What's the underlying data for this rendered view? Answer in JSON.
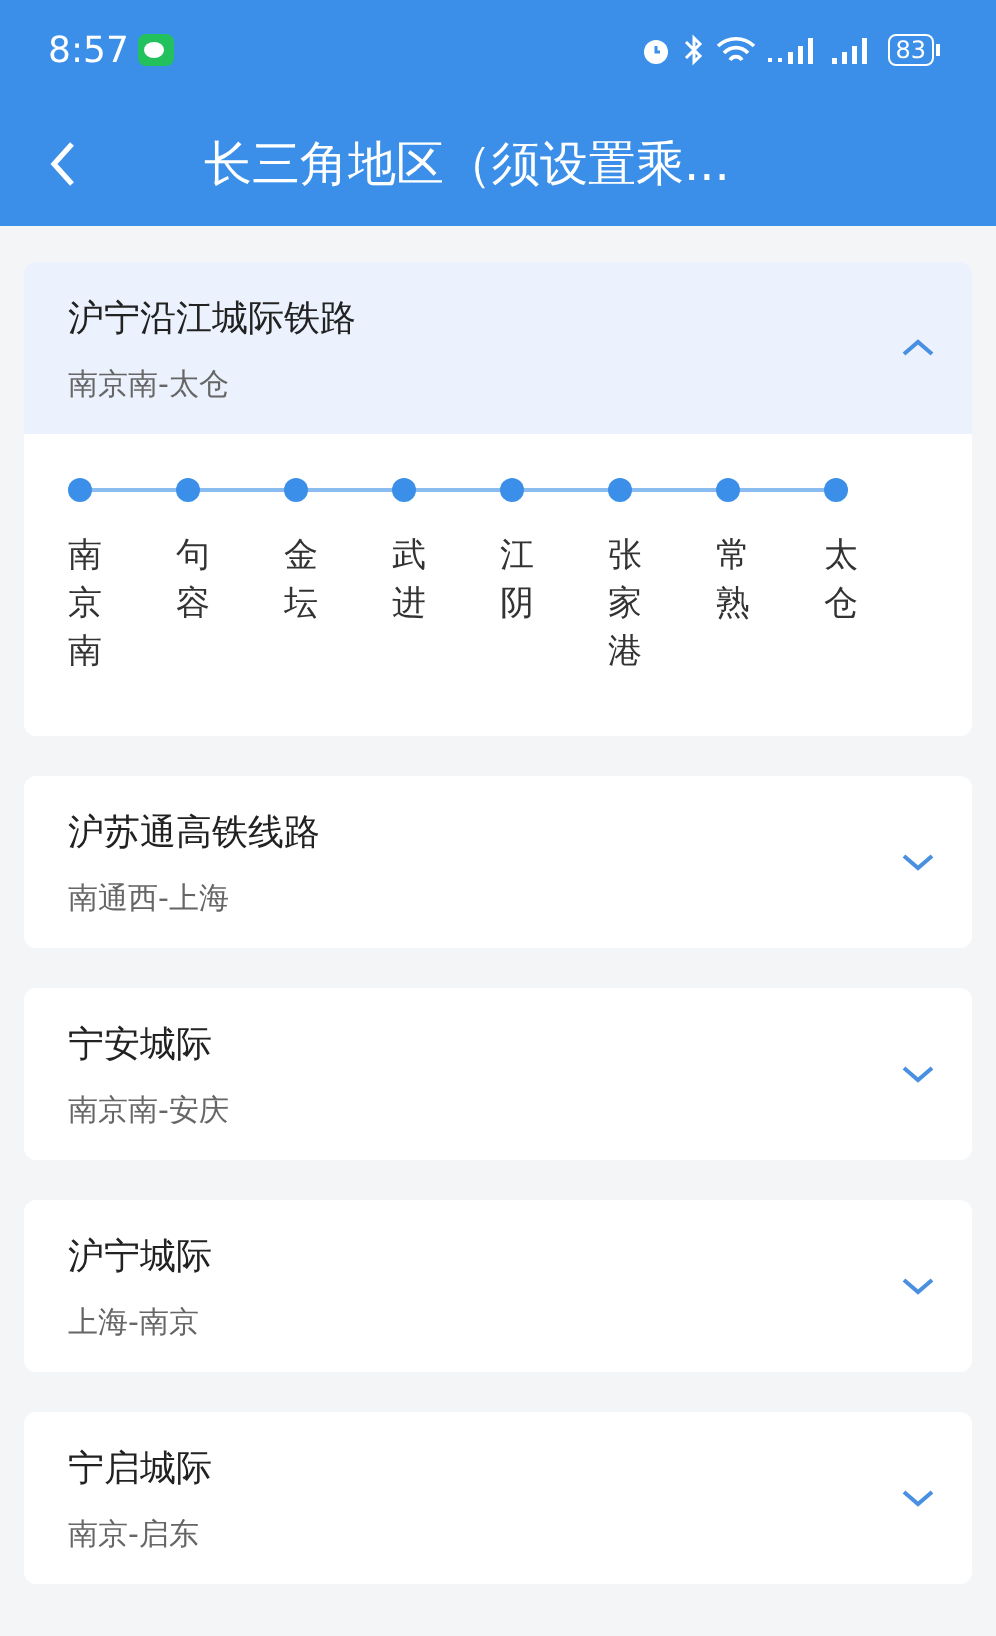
{
  "status_bar": {
    "time": "8:57",
    "battery": "83"
  },
  "header": {
    "title": "长三角地区（须设置乘..."
  },
  "lines": [
    {
      "name": "沪宁沿江城际铁路",
      "route": "南京南-太仓",
      "expanded": true,
      "stations": [
        "南京南",
        "句容",
        "金坛",
        "武进",
        "江阴",
        "张家港",
        "常熟",
        "太仓"
      ]
    },
    {
      "name": "沪苏通高铁线路",
      "route": "南通西-上海",
      "expanded": false
    },
    {
      "name": "宁安城际",
      "route": "南京南-安庆",
      "expanded": false
    },
    {
      "name": "沪宁城际",
      "route": "上海-南京",
      "expanded": false
    },
    {
      "name": "宁启城际",
      "route": "南京-启东",
      "expanded": false
    }
  ]
}
